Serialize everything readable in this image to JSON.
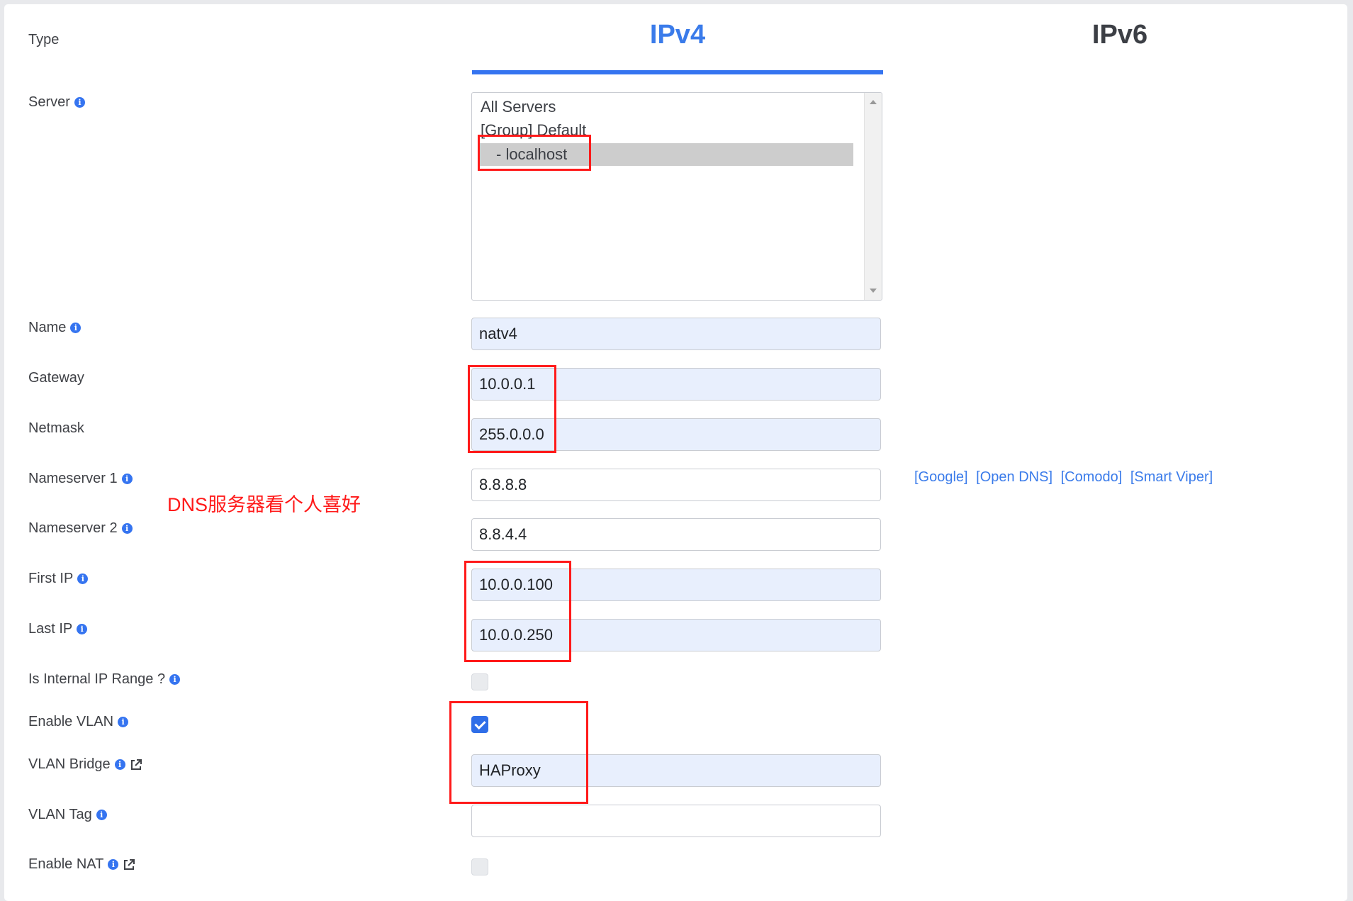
{
  "tabs": {
    "ipv4": "IPv4",
    "ipv6": "IPv6"
  },
  "labels": {
    "type": "Type",
    "server": "Server",
    "name": "Name",
    "gateway": "Gateway",
    "netmask": "Netmask",
    "nameserver1": "Nameserver 1",
    "nameserver2": "Nameserver 2",
    "first_ip": "First IP",
    "last_ip": "Last IP",
    "is_internal": "Is Internal IP Range ?",
    "enable_vlan": "Enable VLAN",
    "vlan_bridge": "VLAN Bridge",
    "vlan_tag": "VLAN Tag",
    "enable_nat": "Enable NAT"
  },
  "info_glyph": "i",
  "server_options": [
    "All Servers",
    "[Group] Default",
    "- localhost"
  ],
  "fields": {
    "name": "natv4",
    "gateway": "10.0.0.1",
    "netmask": "255.0.0.0",
    "nameserver1": "8.8.8.8",
    "nameserver2": "8.8.4.4",
    "first_ip": "10.0.0.100",
    "last_ip": "10.0.0.250",
    "vlan_bridge": "HAProxy",
    "vlan_tag": ""
  },
  "checkboxes": {
    "is_internal": false,
    "enable_vlan": true,
    "enable_nat": false
  },
  "dns_links": [
    "[Google]",
    "[Open DNS]",
    "[Comodo]",
    "[Smart Viper]"
  ],
  "annotation": "DNS服务器看个人喜好",
  "colors": {
    "accent": "#3a7bea",
    "annotation": "#ff1a1a",
    "filled_field": "#e8effd"
  }
}
